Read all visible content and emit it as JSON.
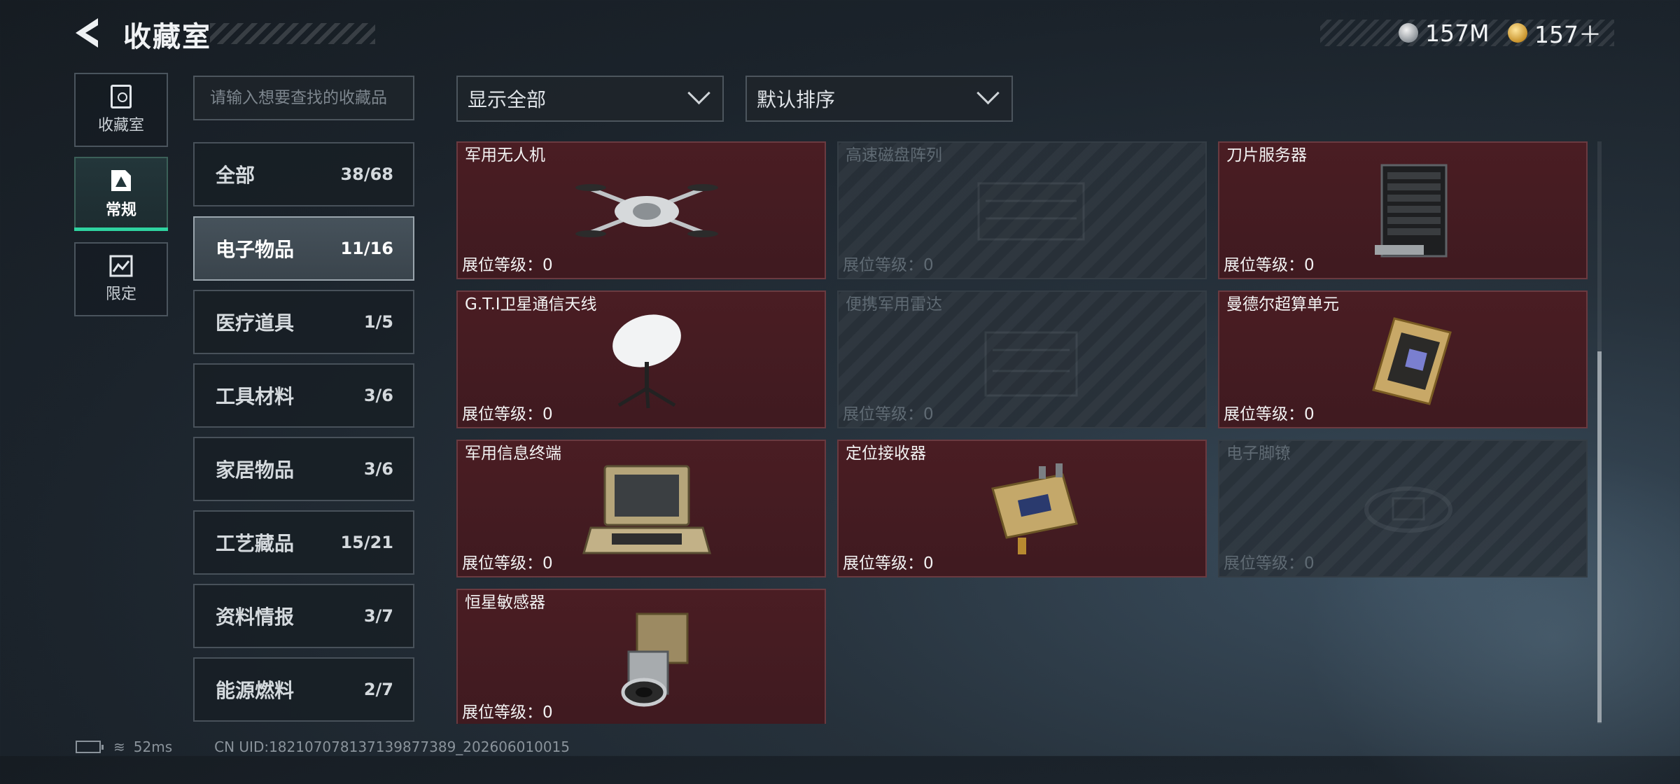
{
  "header": {
    "title": "收藏室",
    "currencies": [
      {
        "icon": "silver-coin-icon",
        "value": "157M"
      },
      {
        "icon": "gold-coin-icon",
        "value": "157＋"
      }
    ]
  },
  "mode_tabs": [
    {
      "label": "收藏室",
      "icon": "vault-icon",
      "active": false
    },
    {
      "label": "常规",
      "icon": "regular-collection-icon",
      "active": true
    },
    {
      "label": "限定",
      "icon": "limited-collection-icon",
      "active": false
    }
  ],
  "search": {
    "placeholder": "请输入想要查找的收藏品"
  },
  "categories": [
    {
      "name": "全部",
      "count": "38/68",
      "active": false
    },
    {
      "name": "电子物品",
      "count": "11/16",
      "active": true
    },
    {
      "name": "医疗道具",
      "count": "1/5",
      "active": false
    },
    {
      "name": "工具材料",
      "count": "3/6",
      "active": false
    },
    {
      "name": "家居物品",
      "count": "3/6",
      "active": false
    },
    {
      "name": "工艺藏品",
      "count": "15/21",
      "active": false
    },
    {
      "name": "资料情报",
      "count": "3/7",
      "active": false
    },
    {
      "name": "能源燃料",
      "count": "2/7",
      "active": false
    }
  ],
  "filters": {
    "display": "显示全部",
    "sort": "默认排序"
  },
  "items": [
    {
      "name": "军用无人机",
      "level": "展位等级：0",
      "collected": true,
      "icon": "military-drone-icon"
    },
    {
      "name": "高速磁盘阵列",
      "level": "展位等级：0",
      "collected": false,
      "icon": "disk-array-icon"
    },
    {
      "name": "刀片服务器",
      "level": "展位等级：0",
      "collected": true,
      "icon": "blade-server-icon"
    },
    {
      "name": "G.T.I卫星通信天线",
      "level": "展位等级：0",
      "collected": true,
      "icon": "satellite-dish-icon"
    },
    {
      "name": "便携军用雷达",
      "level": "展位等级：0",
      "collected": false,
      "icon": "portable-radar-icon"
    },
    {
      "name": "曼德尔超算单元",
      "level": "展位等级：0",
      "collected": true,
      "icon": "supercomputer-unit-icon"
    },
    {
      "name": "军用信息终端",
      "level": "展位等级：0",
      "collected": true,
      "icon": "military-terminal-icon"
    },
    {
      "name": "定位接收器",
      "level": "展位等级：0",
      "collected": true,
      "icon": "gps-receiver-icon"
    },
    {
      "name": "电子脚镣",
      "level": "展位等级：0",
      "collected": false,
      "icon": "electronic-shackle-icon"
    },
    {
      "name": "恒星敏感器",
      "level": "展位等级：0",
      "collected": true,
      "icon": "star-sensor-icon"
    }
  ],
  "footer": {
    "ping": "52ms",
    "uid": "CN UID:1821070781371398773​89_202606010015"
  }
}
